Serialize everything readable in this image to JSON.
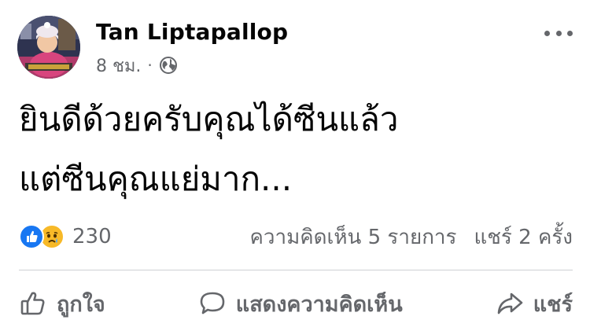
{
  "post": {
    "author": "Tan Liptapallop",
    "time": "8 ชม.",
    "separator": "·",
    "privacy_icon": "globe-icon",
    "text_lines": [
      "ยินดีด้วยครับคุณได้ซีนแล้ว",
      "แต่ซีนคุณแย่มาก..."
    ]
  },
  "reactions": {
    "icons": [
      "like-reaction-icon",
      "sad-reaction-icon"
    ],
    "count": "230",
    "comments": "ความคิดเห็น 5 รายการ",
    "shares": "แชร์ 2 ครั้ง"
  },
  "actions": {
    "like": "ถูกใจ",
    "comment": "แสดงความคิดเห็น",
    "share": "แชร์"
  },
  "colors": {
    "secondary_text": "#65676b",
    "like_blue": "#1877f2",
    "sad_yellow": "#f7b928",
    "divider": "#ced0d4"
  }
}
